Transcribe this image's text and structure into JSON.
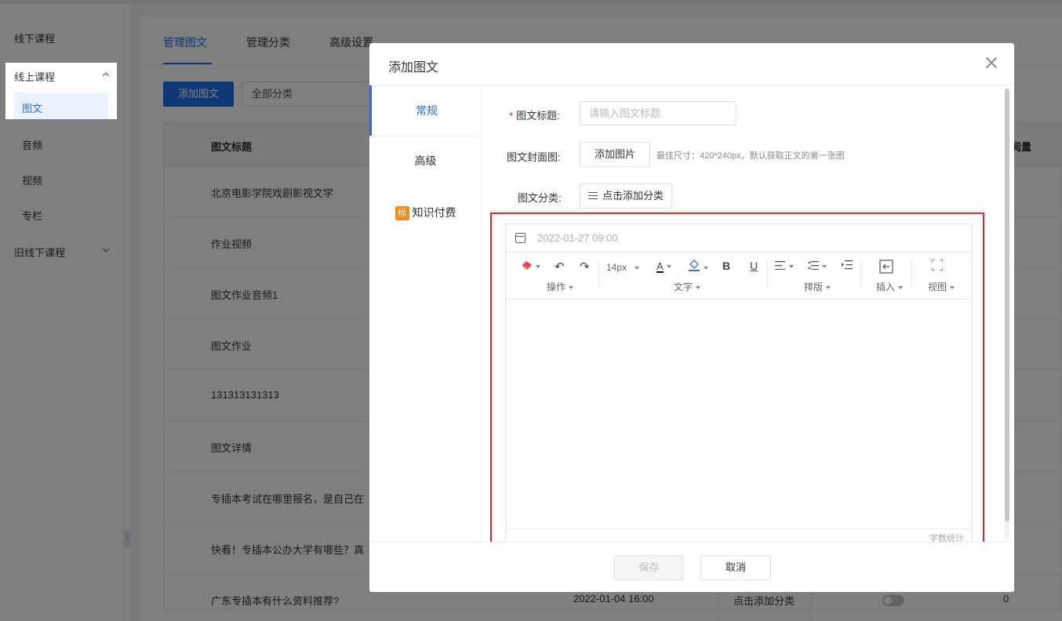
{
  "sidebar": {
    "offline_courses": "线下课程",
    "online_courses": "线上课程",
    "sub_items": [
      "图文",
      "音频",
      "视频",
      "专栏"
    ],
    "old_offline_courses": "旧线下课程"
  },
  "main": {
    "tabs": [
      "管理图文",
      "管理分类",
      "高级设置"
    ],
    "add_button": "添加图文",
    "category_select": "全部分类",
    "table": {
      "col_title": "图文标题",
      "col_read_partial": "阅量",
      "rows": [
        {
          "title": "北京电影学院戏剧影视文学"
        },
        {
          "title": "作业视频"
        },
        {
          "title": "图文作业音频1"
        },
        {
          "title": "图文作业"
        },
        {
          "title": "131313131313"
        },
        {
          "title": "图文详情"
        },
        {
          "title": "专插本考试在哪里报名，是自己在"
        },
        {
          "title": "快看！专插本公办大学有哪些？真"
        },
        {
          "title": "广东专插本有什么资料推荐?",
          "date": "2022-01-04 16:00",
          "category": "点击添加分类",
          "read": "0"
        }
      ]
    }
  },
  "modal": {
    "title": "添加图文",
    "nav": {
      "general": "常规",
      "advanced": "高级",
      "paid_badge": "标",
      "paid": "知识付费"
    },
    "form": {
      "title_label": "图文标题:",
      "title_placeholder": "请输入图文标题",
      "cover_label": "图文封面图:",
      "cover_button": "添加图片",
      "cover_hint": "最佳尺寸：420*240px，默认获取正文的第一张图",
      "category_label": "图文分类:",
      "category_button": "点击添加分类"
    },
    "editor": {
      "date": "2022-01-27 09:00",
      "font_size": "14px",
      "groups": {
        "operation": "操作",
        "text": "文字",
        "layout": "排版",
        "insert": "插入",
        "view": "视图"
      },
      "word_count": "字数统计"
    },
    "footer": {
      "save": "保存",
      "cancel": "取消"
    }
  }
}
